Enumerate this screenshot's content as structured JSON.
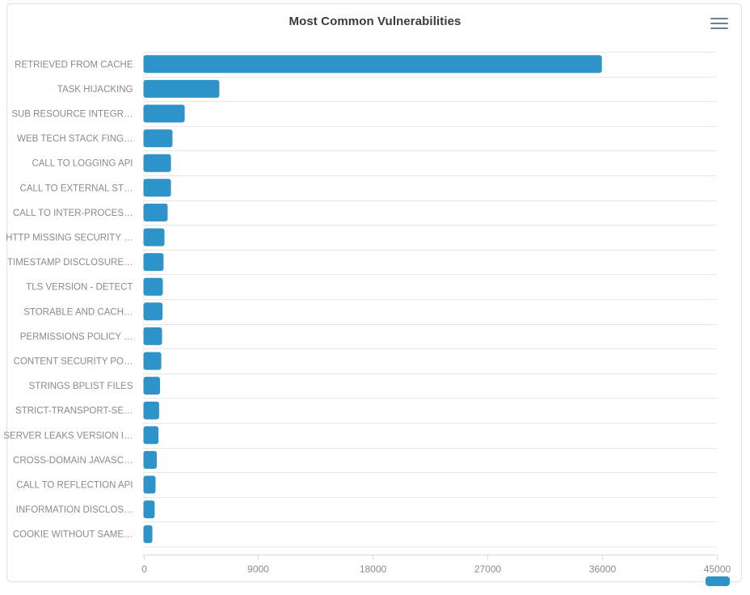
{
  "card": {
    "title": "Most Common Vulnerabilities",
    "menu_icon": "hamburger-menu-icon"
  },
  "chart_data": {
    "type": "bar",
    "orientation": "horizontal",
    "title": "Most Common Vulnerabilities",
    "xlabel": "",
    "ylabel": "",
    "xlim": [
      0,
      45000
    ],
    "xticks": [
      0,
      9000,
      18000,
      27000,
      36000,
      45000
    ],
    "xtick_labels": [
      "0",
      "9000",
      "18000",
      "27000",
      "36000",
      "45000"
    ],
    "grid": "horizontal",
    "legend": "none",
    "bar_color": "#2e93c8",
    "categories": [
      "RETRIEVED FROM CACHE",
      "TASK HIJACKING",
      "SUB RESOURCE INTEGR…",
      "WEB TECH STACK FING…",
      "CALL TO LOGGING API",
      "CALL TO EXTERNAL ST…",
      "CALL TO INTER-PROCES…",
      "HTTP MISSING SECURITY …",
      "TIMESTAMP DISCLOSURE…",
      "TLS VERSION - DETECT",
      "STORABLE AND CACH…",
      "PERMISSIONS POLICY …",
      "CONTENT SECURITY PO…",
      "STRINGS BPLIST FILES",
      "STRICT-TRANSPORT-SE…",
      "SERVER LEAKS VERSION I…",
      "CROSS-DOMAIN JAVASC…",
      "CALL TO REFLECTION API",
      "INFORMATION DISCLOS…",
      "COOKIE WITHOUT SAME…"
    ],
    "values": [
      36000,
      5960,
      3240,
      2280,
      2160,
      2160,
      1900,
      1650,
      1580,
      1520,
      1500,
      1460,
      1400,
      1300,
      1230,
      1180,
      1050,
      950,
      880,
      700
    ]
  }
}
